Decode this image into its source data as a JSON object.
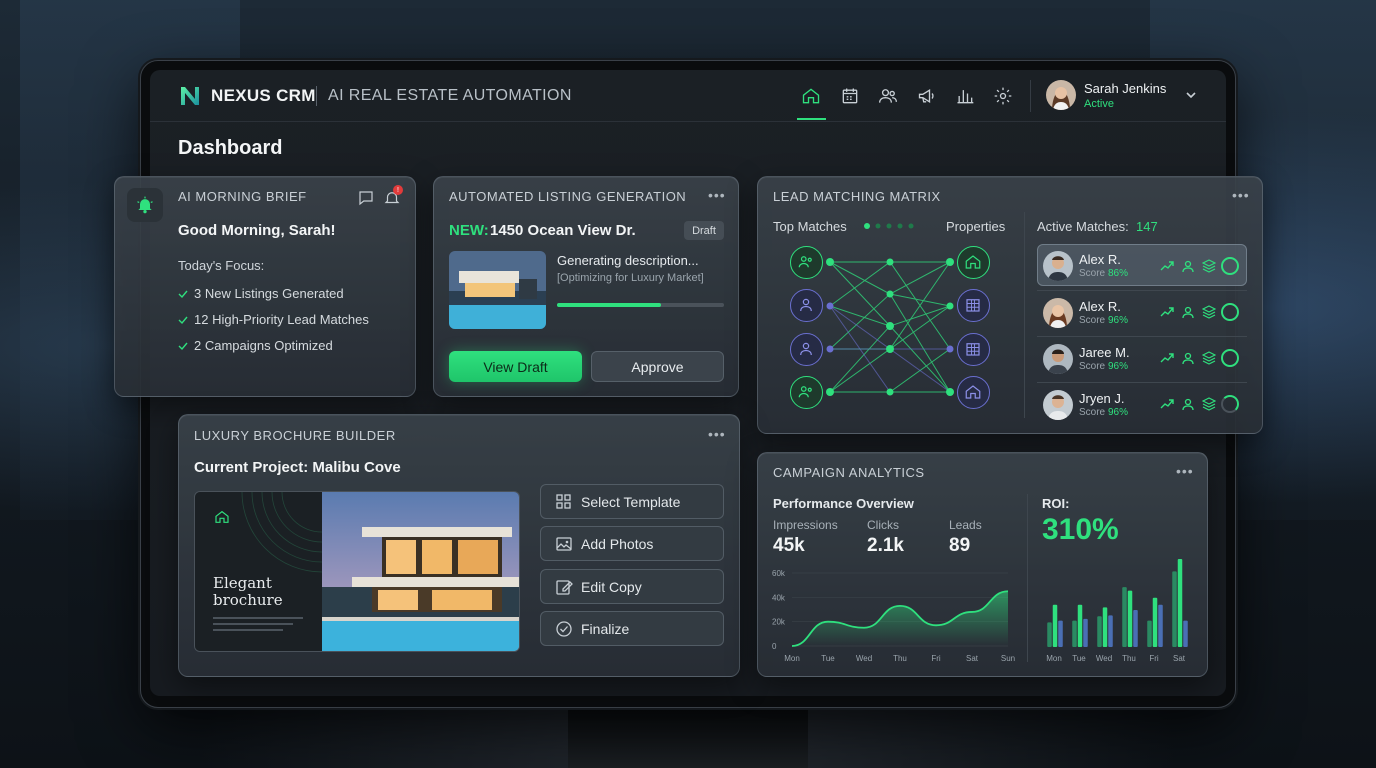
{
  "app": {
    "brand": "NEXUS CRM",
    "subtitle": "AI REAL ESTATE AUTOMATION"
  },
  "nav": {
    "items": [
      "home-icon",
      "calendar-icon",
      "users-icon",
      "megaphone-icon",
      "bar-chart-icon",
      "gear-icon"
    ],
    "active": "home-icon"
  },
  "user": {
    "name": "Sarah Jenkins",
    "status": "Active"
  },
  "page": {
    "title": "Dashboard"
  },
  "brief": {
    "title": "AI MORNING BRIEF",
    "greeting": "Good Morning, Sarah!",
    "focus_label": "Today's Focus:",
    "items": [
      "3 New Listings Generated",
      "12 High-Priority Lead Matches",
      "2 Campaigns Optimized"
    ],
    "notification_badge": "!"
  },
  "listing": {
    "title": "AUTOMATED LISTING GENERATION",
    "new_prefix": "NEW:",
    "address": "1450 Ocean View Dr.",
    "badge": "Draft",
    "status": "Generating description...",
    "substatus": "[Optimizing for Luxury Market]",
    "progress": 0.62,
    "view_label": "View Draft",
    "approve_label": "Approve"
  },
  "matrix": {
    "title": "LEAD MATCHING MATRIX",
    "left_label": "Top Matches",
    "right_label": "Properties",
    "active_label": "Active Matches:",
    "active_count": "147",
    "score_label": "Score",
    "matches": [
      {
        "name": "Alex R.",
        "score": "86%"
      },
      {
        "name": "Alex R.",
        "score": "96%"
      },
      {
        "name": "Jaree M.",
        "score": "96%"
      },
      {
        "name": "Jryen J.",
        "score": "96%"
      }
    ]
  },
  "brochure": {
    "title": "LUXURY BROCHURE BUILDER",
    "project_label": "Current Project: Malibu Cove",
    "preview_heading_1": "Elegant",
    "preview_heading_2": "brochure",
    "actions": [
      "Select Template",
      "Add Photos",
      "Edit Copy",
      "Finalize"
    ]
  },
  "analytics": {
    "title": "CAMPAIGN ANALYTICS",
    "overview": "Performance Overview",
    "stats": [
      {
        "label": "Impressions",
        "value": "45k"
      },
      {
        "label": "Clicks",
        "value": "2.1k"
      },
      {
        "label": "Leads",
        "value": "89"
      }
    ],
    "roi_label": "ROI:",
    "roi_value": "310%",
    "colors": {
      "accent": "#2fe07e",
      "secondary": "#4a6fb5"
    }
  },
  "chart_data": [
    {
      "type": "area",
      "categories": [
        "Mon",
        "Tue",
        "Wed",
        "Thu",
        "Fri",
        "Sat",
        "Sun"
      ],
      "yticks": [
        "0",
        "20k",
        "40k",
        "60k"
      ],
      "ylim": [
        0,
        60000
      ],
      "series": [
        {
          "values": [
            0,
            20000,
            15000,
            33000,
            17000,
            28000,
            45000
          ]
        }
      ]
    },
    {
      "type": "bar",
      "categories": [
        "Mon",
        "Tue",
        "Wed",
        "Thu",
        "Fri",
        "Sat"
      ],
      "series": [
        {
          "values": [
            28,
            30,
            35,
            68,
            30,
            86
          ]
        },
        {
          "values": [
            48,
            48,
            45,
            64,
            56,
            100
          ]
        },
        {
          "values": [
            30,
            32,
            36,
            42,
            48,
            30
          ]
        }
      ]
    }
  ]
}
